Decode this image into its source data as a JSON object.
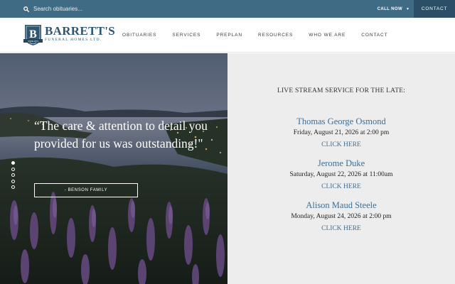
{
  "topbar": {
    "search_placeholder": "Search obituaries...",
    "call_now": "CALL NOW",
    "contact": "CONTACT"
  },
  "logo": {
    "crest_letter": "B",
    "crest_band": "SINCE 1874",
    "name": "BARRETT'S",
    "subtitle": "FUNERAL HOMES LTD."
  },
  "nav": {
    "items": [
      "OBITUARIES",
      "SERVICES",
      "PREPLAN",
      "RESOURCES",
      "WHO WE ARE",
      "CONTACT"
    ]
  },
  "hero": {
    "quote": "“The care & attention to detail you provided for us was outstanding!\"",
    "attribution": "- BENSON FAMILY",
    "slides_total": 5,
    "slide_active": 1
  },
  "livestream": {
    "heading": "LIVE STREAM SERVICE FOR THE LATE:",
    "services": [
      {
        "name": "Thomas George Osmond",
        "date": "Friday, August 21, 2026 at 2:00 pm",
        "link": "CLICK HERE"
      },
      {
        "name": "Jerome Duke",
        "date": "Saturday, August 22, 2026 at 11:00am",
        "link": "CLICK HERE"
      },
      {
        "name": "Alison Maud Steele",
        "date": "Monday, August 24, 2026 at 2:00 pm",
        "link": "CLICK HERE"
      }
    ]
  },
  "colors": {
    "topbar": "#3f6b85",
    "topbar_contact": "#2b4f66",
    "brand_blue": "#2f5671",
    "link_blue": "#3d6f96",
    "panel_gray": "#ededed"
  },
  "icons": {
    "search": "search-icon",
    "caret": "caret-down-icon",
    "crest": "crest-logo-icon"
  }
}
